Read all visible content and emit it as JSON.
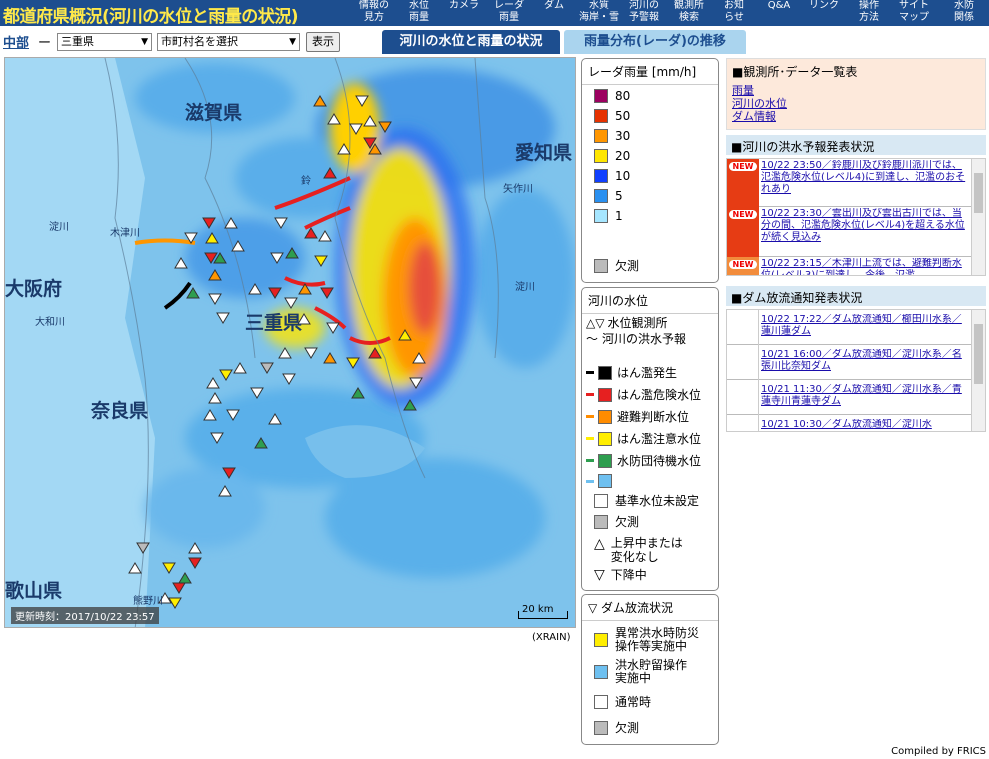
{
  "header": {
    "title": "都道府県概況(河川の水位と雨量の状況)",
    "nav": [
      {
        "top": "情報の",
        "bottom": "見方"
      },
      {
        "top": "水位",
        "bottom": "雨量"
      },
      {
        "top": "カメラ",
        "bottom": ""
      },
      {
        "top": "レーダ",
        "bottom": "雨量"
      },
      {
        "top": "ダム",
        "bottom": ""
      },
      {
        "top": "水質",
        "bottom": "海岸・雪"
      },
      {
        "top": "河川の",
        "bottom": "予警報"
      },
      {
        "top": "観測所",
        "bottom": "検索"
      },
      {
        "top": "お知",
        "bottom": "らせ"
      },
      {
        "top": "Q&A",
        "bottom": ""
      },
      {
        "top": "リンク",
        "bottom": ""
      },
      {
        "top": "操作",
        "bottom": "方法"
      },
      {
        "top": "サイト",
        "bottom": "マップ"
      },
      {
        "top": "水防",
        "bottom": "関係"
      }
    ]
  },
  "selector": {
    "region": "中部",
    "dash": "ー",
    "prefecture": "三重県",
    "municipality_placeholder": "市町村名を選択",
    "show_button": "表示"
  },
  "tabs": {
    "river": "河川の水位と雨量の状況",
    "radar": "雨量分布(レーダ)の推移"
  },
  "map": {
    "labels": {
      "shiga": "滋賀県",
      "aichi": "愛知県",
      "osaka": "大阪府",
      "mie": "三重県",
      "nara": "奈良県",
      "wakayama": "歌山県"
    },
    "small_labels": {
      "yodogawa1": "淀川",
      "kizugawa": "木津川",
      "yamatogawa": "大和川",
      "yahagigawa": "矢作川",
      "yodogawa2": "淀川",
      "suzuka": "鈴",
      "kumano": "熊野川"
    },
    "update_time": "更新時刻：2017/10/22 23:57",
    "scale": "20 km",
    "source": "(XRAIN)"
  },
  "legend_radar": {
    "title": "レーダ雨量 [mm/h]",
    "items": [
      {
        "label": "80",
        "color": "#9c0060"
      },
      {
        "label": "50",
        "color": "#e63200"
      },
      {
        "label": "30",
        "color": "#ff9600"
      },
      {
        "label": "20",
        "color": "#ffe600"
      },
      {
        "label": "10",
        "color": "#1040ff"
      },
      {
        "label": "5",
        "color": "#2a90f0"
      },
      {
        "label": "1",
        "color": "#a6e6ff"
      }
    ],
    "missing": "欠測",
    "missing_color": "#bbbbbb"
  },
  "legend_river": {
    "title": "河川の水位",
    "station": "水位観測所",
    "forecast": "河川の洪水予報",
    "levels": [
      {
        "label": "はん濫発生",
        "color": "#000000"
      },
      {
        "label": "はん濫危険水位",
        "color": "#e62020"
      },
      {
        "label": "避難判断水位",
        "color": "#ff8c00"
      },
      {
        "label": "はん濫注意水位",
        "color": "#ffee00"
      },
      {
        "label": "水防団待機水位",
        "color": "#2e9e4f"
      },
      {
        "label": "",
        "color": "#6ec0f0"
      }
    ],
    "not_set": "基準水位未設定",
    "missing": "欠測",
    "rising_1": "上昇中または",
    "rising_2": "変化なし",
    "falling": "下降中"
  },
  "legend_dam": {
    "title": "ダム放流状況",
    "items": [
      {
        "line1": "異常洪水時防災",
        "line2": "操作等実施中",
        "color": "#ffee00"
      },
      {
        "line1": "洪水貯留操作",
        "line2": "実施中",
        "color": "#6ec0f0"
      },
      {
        "line1": "通常時",
        "line2": "",
        "color": "#ffffff"
      },
      {
        "line1": "欠測",
        "line2": "",
        "color": "#bbbbbb"
      }
    ]
  },
  "data_list": {
    "title": "■観測所･データ一覧表",
    "links": [
      "雨量",
      "河川の水位",
      "ダム情報"
    ]
  },
  "flood_news": {
    "title": "■河川の洪水予報発表状況",
    "badge": "NEW",
    "items": [
      "10/22 23:50／鈴鹿川及び鈴鹿川派川では、氾濫危険水位(レベル4)に到達し、氾濫のおそれあり",
      "10/22 23:30／雲出川及び雲出古川では、当分の間、氾濫危険水位(レベル4)を超える水位が続く見込み",
      "10/22 23:15／木津川上流では、避難判断水位(レベル3)に到達し、今後、氾濫"
    ]
  },
  "dam_news": {
    "title": "■ダム放流通知発表状況",
    "items": [
      "10/22 17:22／ダム放流通知／櫛田川水系／蓮川蓮ダム",
      "10/21 16:00／ダム放流通知／淀川水系／名張川比奈知ダム",
      "10/21 11:30／ダム放流通知／淀川水系／青蓮寺川青蓮寺ダム",
      "10/21 10:30／ダム放流通知／淀川水"
    ]
  },
  "footer": "Compiled by FRICS"
}
